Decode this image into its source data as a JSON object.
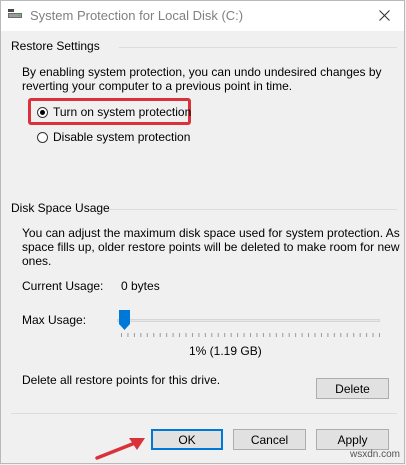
{
  "window": {
    "title": "System Protection for Local Disk (C:)",
    "close_label": "✕"
  },
  "restore": {
    "heading": "Restore Settings",
    "description_line1": "By enabling system protection, you can undo undesired changes by",
    "description_line2": "reverting your computer to a previous point in time.",
    "option_on": "Turn on system protection",
    "option_off": "Disable system protection",
    "selected": "on"
  },
  "disk": {
    "heading": "Disk Space Usage",
    "description_line1": "You can adjust the maximum disk space used for system protection. As",
    "description_line2": "space fills up, older restore points will be deleted to make room for new",
    "description_line3": "ones.",
    "current_usage_label": "Current Usage:",
    "current_usage_value": "0 bytes",
    "max_usage_label": "Max Usage:",
    "max_usage_fraction": 0.01,
    "max_usage_readout": "1% (1.19 GB)",
    "delete_text": "Delete all restore points for this drive.",
    "delete_button": "Delete"
  },
  "buttons": {
    "ok": "OK",
    "cancel": "Cancel",
    "apply": "Apply"
  },
  "watermark": "wsxdn.com",
  "colors": {
    "highlight": "#d9323b",
    "slider_thumb": "#0078d7"
  },
  "icons": {
    "title": "drive-icon",
    "close": "close-icon",
    "annotation": "arrow-annotation"
  }
}
